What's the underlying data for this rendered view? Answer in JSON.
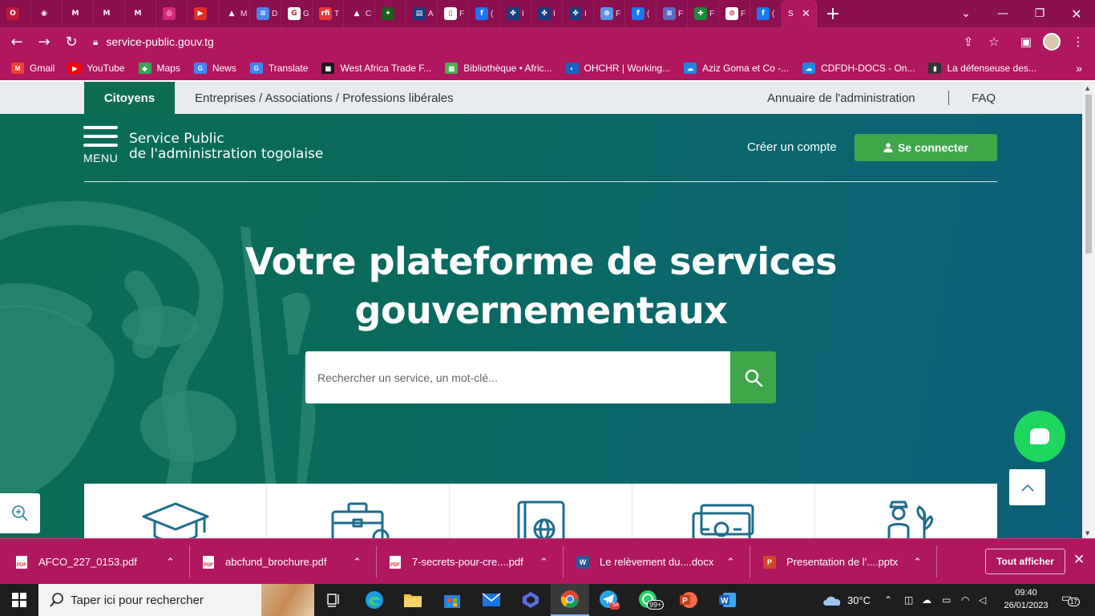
{
  "browser": {
    "tabs": [
      {
        "icon": "opera-icon",
        "color": "#c0183c",
        "letter": "O",
        "title": ""
      },
      {
        "icon": "globe-icon",
        "color": "#8c0f4f",
        "letter": "◉",
        "title": ""
      },
      {
        "icon": "gmail-icon",
        "color": "#8c0f4f",
        "letter": "M",
        "title": ""
      },
      {
        "icon": "gmail-icon",
        "color": "#8c0f4f",
        "letter": "M",
        "title": ""
      },
      {
        "icon": "gmail-icon",
        "color": "#8c0f4f",
        "letter": "M",
        "title": ""
      },
      {
        "icon": "instagram-icon",
        "color": "#d6287a",
        "letter": "◎",
        "title": ""
      },
      {
        "icon": "youtube-icon",
        "color": "#e52d27",
        "letter": "▶",
        "title": ""
      },
      {
        "icon": "drive-icon",
        "color": "#8c0f4f",
        "letter": "▲",
        "title": "M"
      },
      {
        "icon": "docs-icon",
        "color": "#4a86e8",
        "letter": "≡",
        "title": "D"
      },
      {
        "icon": "google-icon",
        "color": "#ffffff",
        "letter": "G",
        "title": "G"
      },
      {
        "icon": "rfi-icon",
        "color": "#e53935",
        "letter": "rfi",
        "title": "T"
      },
      {
        "icon": "mountain-icon",
        "color": "#8c0f4f",
        "letter": "▲",
        "title": "C"
      },
      {
        "icon": "leaf-icon",
        "color": "#1b5e20",
        "letter": "✦",
        "title": ""
      },
      {
        "icon": "news-icon",
        "color": "#1a3d7c",
        "letter": "▤",
        "title": "A"
      },
      {
        "icon": "page-icon",
        "color": "#ffffff",
        "letter": "▯",
        "title": "F"
      },
      {
        "icon": "facebook-icon",
        "color": "#1877f2",
        "letter": "f",
        "title": "("
      },
      {
        "icon": "francophonie-icon",
        "color": "#1a3d7c",
        "letter": "✤",
        "title": "I"
      },
      {
        "icon": "francophonie-icon",
        "color": "#1a3d7c",
        "letter": "✤",
        "title": "I"
      },
      {
        "icon": "francophonie-icon",
        "color": "#1a3d7c",
        "letter": "✤",
        "title": "I"
      },
      {
        "icon": "un-icon",
        "color": "#5b92e5",
        "letter": "⊕",
        "title": "F"
      },
      {
        "icon": "facebook-icon",
        "color": "#1877f2",
        "letter": "f",
        "title": "("
      },
      {
        "icon": "list-icon",
        "color": "#5c6bc0",
        "letter": "≡",
        "title": "F"
      },
      {
        "icon": "cross-icon",
        "color": "#1b8a3c",
        "letter": "✚",
        "title": "F"
      },
      {
        "icon": "circle-icon",
        "color": "#ffffff",
        "letter": "⊘",
        "title": "F"
      },
      {
        "icon": "facebook-icon",
        "color": "#1877f2",
        "letter": "f",
        "title": "("
      }
    ],
    "active_tab": {
      "title": "S",
      "close": "✕"
    },
    "new_tab": "+",
    "url": "service-public.gouv.tg",
    "bookmarks": [
      {
        "label": "Gmail",
        "icon": "gmail-icon",
        "color": "#ea4335",
        "glyph": "M"
      },
      {
        "label": "YouTube",
        "icon": "youtube-icon",
        "color": "#ff0000",
        "glyph": "▶"
      },
      {
        "label": "Maps",
        "icon": "maps-icon",
        "color": "#34a853",
        "glyph": "◆"
      },
      {
        "label": "News",
        "icon": "news-icon",
        "color": "#4285f4",
        "glyph": "G"
      },
      {
        "label": "Translate",
        "icon": "translate-icon",
        "color": "#4285f4",
        "glyph": "G"
      },
      {
        "label": "West Africa Trade F...",
        "icon": "trade-icon",
        "color": "#1a1a1a",
        "glyph": "▦"
      },
      {
        "label": "Bibliothèque • Afric...",
        "icon": "library-icon",
        "color": "#4caf50",
        "glyph": "▧"
      },
      {
        "label": "OHCHR | Working...",
        "icon": "ohchr-icon",
        "color": "#1565c0",
        "glyph": "◐"
      },
      {
        "label": "Aziz Goma et Co -...",
        "icon": "onedrive-icon",
        "color": "#1e88e5",
        "glyph": "☁"
      },
      {
        "label": "CDFDH-DOCS - On...",
        "icon": "onedrive-icon",
        "color": "#1e88e5",
        "glyph": "☁"
      },
      {
        "label": "La défenseuse des...",
        "icon": "person-icon",
        "color": "#333333",
        "glyph": "▮"
      }
    ],
    "bookmarks_more": "»"
  },
  "site": {
    "topbar": {
      "citoyens": "Citoyens",
      "entreprises": "Entreprises / Associations / Professions libérales",
      "annuaire": "Annuaire de l'administration",
      "faq": "FAQ"
    },
    "menu_label": "MENU",
    "brand_line1": "Service Public",
    "brand_line2": "de l'administration togolaise",
    "create_account": "Créer un compte",
    "login": "Se connecter",
    "hero_line1": "Votre plateforme de services",
    "hero_line2": "gouvernementaux",
    "search_placeholder": "Rechercher un service, un mot-clé...",
    "categories": [
      {
        "icon": "graduation-cap-icon"
      },
      {
        "icon": "briefcase-icon"
      },
      {
        "icon": "passport-icon"
      },
      {
        "icon": "money-icon"
      },
      {
        "icon": "farmer-icon"
      }
    ],
    "colors": {
      "green": "#3fa64a",
      "teal": "#0b6670",
      "chat": "#1fd65f",
      "icon_blue": "#2b7fa0"
    }
  },
  "downloads": {
    "items": [
      {
        "name": "AFCO_227_0153.pdf",
        "type": "pdf"
      },
      {
        "name": "abcfund_brochure.pdf",
        "type": "pdf"
      },
      {
        "name": "7-secrets-pour-cre....pdf",
        "type": "pdf"
      },
      {
        "name": "Le relèvement du....docx",
        "type": "docx"
      },
      {
        "name": "Presentation de l'....pptx",
        "type": "pptx"
      }
    ],
    "show_all": "Tout afficher"
  },
  "taskbar": {
    "search_placeholder": "Taper ici pour rechercher",
    "weather": "30°C",
    "time": "09:40",
    "date": "26/01/2023",
    "whatsapp_badge": "99+",
    "telegram_badge": "54",
    "notifications": "17"
  }
}
